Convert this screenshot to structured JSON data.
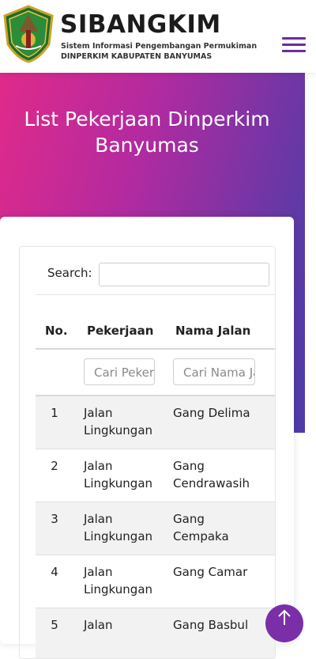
{
  "header": {
    "brand_name": "SIBANGKIM",
    "subtitle_line1": "Sistem Informasi Pengembangan Permukiman",
    "subtitle_line2": "DINPERKIM KABUPATEN BANYUMAS",
    "logo_icon": "banyumas-regency-seal",
    "menu_icon": "hamburger-menu-icon"
  },
  "hero": {
    "title": "List Pekerjaan Dinperkim Banyumas"
  },
  "table": {
    "search_label": "Search:",
    "search_value": "",
    "columns": [
      "No.",
      "Pekerjaan",
      "Nama Jalan"
    ],
    "filter_pekerjaan_placeholder": "Cari Pekerjaan",
    "filter_jalan_placeholder": "Cari Nama Jalan",
    "rows": [
      {
        "no": "1",
        "pekerjaan": "Jalan Lingkungan",
        "jalan": "Gang Delima"
      },
      {
        "no": "2",
        "pekerjaan": "Jalan Lingkungan",
        "jalan": "Gang Cendrawasih"
      },
      {
        "no": "3",
        "pekerjaan": "Jalan Lingkungan",
        "jalan": "Gang Cempaka"
      },
      {
        "no": "4",
        "pekerjaan": "Jalan Lingkungan",
        "jalan": "Gang Camar"
      },
      {
        "no": "5",
        "pekerjaan": "Jalan",
        "jalan": "Gang Basbul"
      }
    ]
  },
  "colors": {
    "accent": "#6a2d9c",
    "gradient_start": "#e02a8a",
    "gradient_end": "#4f3ba8"
  },
  "scroll_top_icon": "arrow-up-icon"
}
